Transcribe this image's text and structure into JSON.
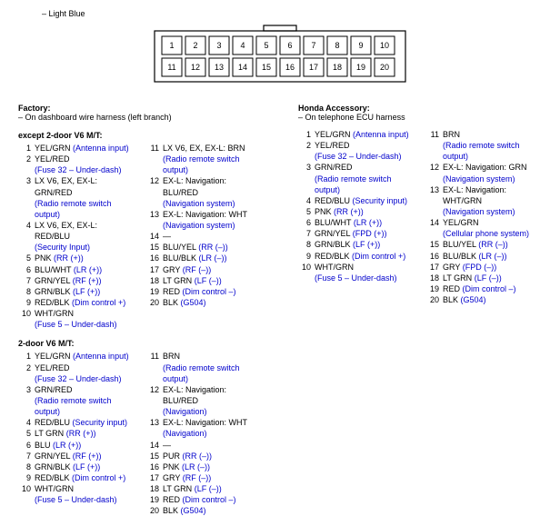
{
  "top_note": "– Light Blue",
  "connector_pins_row1": [
    "1",
    "2",
    "3",
    "4",
    "5",
    "6",
    "7",
    "8",
    "9",
    "10"
  ],
  "connector_pins_row2": [
    "11",
    "12",
    "13",
    "14",
    "15",
    "16",
    "17",
    "18",
    "19",
    "20"
  ],
  "factory": {
    "title": "Factory:",
    "sub": "– On dashboard wire harness (left branch)",
    "groups": [
      {
        "title": "except 2-door V6 M/T:",
        "cols": [
          [
            {
              "n": "1",
              "c": "YEL/GRN",
              "f": "(Antenna input)"
            },
            {
              "n": "2",
              "c": "YEL/RED",
              "f": "",
              "f2": "(Fuse 32 – Under-dash)"
            },
            {
              "n": "3",
              "c": "LX V6, EX, EX-L: GRN/RED",
              "f": "",
              "f2": "(Radio remote switch output)"
            },
            {
              "n": "4",
              "c": "LX V6, EX, EX-L: RED/BLU",
              "f": "",
              "f2": "(Security Input)"
            },
            {
              "n": "5",
              "c": "PNK",
              "f": "(RR (+))"
            },
            {
              "n": "6",
              "c": "BLU/WHT",
              "f": "(LR (+))"
            },
            {
              "n": "7",
              "c": "GRN/YEL",
              "f": "(RF (+))"
            },
            {
              "n": "8",
              "c": "GRN/BLK",
              "f": "(LF (+))"
            },
            {
              "n": "9",
              "c": "RED/BLK",
              "f": "(Dim control +)"
            },
            {
              "n": "10",
              "c": "WHT/GRN",
              "f": "",
              "f2": "(Fuse 5 – Under-dash)"
            }
          ],
          [
            {
              "n": "11",
              "c": "LX V6, EX, EX-L: BRN",
              "f": "",
              "f2": "(Radio remote switch output)"
            },
            {
              "n": "12",
              "c": "EX-L: Navigation: BLU/RED",
              "f": "",
              "f2": "(Navigation system)"
            },
            {
              "n": "13",
              "c": "EX-L: Navigation: WHT",
              "f": "",
              "f2": "(Navigation system)"
            },
            {
              "n": "14",
              "c": "—",
              "f": ""
            },
            {
              "n": "15",
              "c": "BLU/YEL",
              "f": "(RR (–))"
            },
            {
              "n": "16",
              "c": "BLU/BLK",
              "f": "(LR (–))"
            },
            {
              "n": "17",
              "c": "GRY",
              "f": "(RF (–))"
            },
            {
              "n": "18",
              "c": "LT GRN",
              "f": "(LF (–))"
            },
            {
              "n": "19",
              "c": "RED",
              "f": "(Dim control –)"
            },
            {
              "n": "20",
              "c": "BLK",
              "f": "(G504)"
            }
          ]
        ]
      },
      {
        "title": "2-door V6 M/T:",
        "cols": [
          [
            {
              "n": "1",
              "c": "YEL/GRN",
              "f": "(Antenna input)"
            },
            {
              "n": "2",
              "c": "YEL/RED",
              "f": "",
              "f2": "(Fuse 32 – Under-dash)"
            },
            {
              "n": "3",
              "c": "GRN/RED",
              "f": "",
              "f2": "(Radio remote switch output)"
            },
            {
              "n": "4",
              "c": "RED/BLU",
              "f": "(Security input)"
            },
            {
              "n": "5",
              "c": "LT GRN",
              "f": "(RR (+))"
            },
            {
              "n": "6",
              "c": "BLU",
              "f": "(LR (+))"
            },
            {
              "n": "7",
              "c": "GRN/YEL",
              "f": "(RF (+))"
            },
            {
              "n": "8",
              "c": "GRN/BLK",
              "f": "(LF (+))"
            },
            {
              "n": "9",
              "c": "RED/BLK",
              "f": "(Dim control +)"
            },
            {
              "n": "10",
              "c": "WHT/GRN",
              "f": "",
              "f2": "(Fuse 5 – Under-dash)"
            }
          ],
          [
            {
              "n": "11",
              "c": "BRN",
              "f": "",
              "f2": "(Radio remote switch output)"
            },
            {
              "n": "12",
              "c": "EX-L: Navigation: BLU/RED",
              "f": "",
              "f2": "(Navigation)"
            },
            {
              "n": "13",
              "c": "EX-L: Navigation: WHT",
              "f": "",
              "f2": "(Navigation)"
            },
            {
              "n": "14",
              "c": "—",
              "f": ""
            },
            {
              "n": "15",
              "c": "PUR",
              "f": "(RR (–))"
            },
            {
              "n": "16",
              "c": "PNK",
              "f": "(LR (–))"
            },
            {
              "n": "17",
              "c": "GRY",
              "f": "(RF (–))"
            },
            {
              "n": "18",
              "c": "LT GRN",
              "f": "(LF (–))"
            },
            {
              "n": "19",
              "c": "RED",
              "f": "(Dim control –)"
            },
            {
              "n": "20",
              "c": "BLK",
              "f": "(G504)"
            }
          ]
        ]
      }
    ]
  },
  "accessory": {
    "title": "Honda Accessory:",
    "sub": "– On telephone ECU harness",
    "cols": [
      [
        {
          "n": "1",
          "c": "YEL/GRN",
          "f": "(Antenna input)"
        },
        {
          "n": "2",
          "c": "YEL/RED",
          "f": "",
          "f2": "(Fuse 32 – Under-dash)"
        },
        {
          "n": "3",
          "c": "GRN/RED",
          "f": "",
          "f2": "(Radio remote switch output)"
        },
        {
          "n": "4",
          "c": "RED/BLU",
          "f": "(Security input)"
        },
        {
          "n": "5",
          "c": "PNK",
          "f": "(RR (+))"
        },
        {
          "n": "6",
          "c": "BLU/WHT",
          "f": "(LR (+))"
        },
        {
          "n": "7",
          "c": "GRN/YEL",
          "f": "(FPD (+))"
        },
        {
          "n": "8",
          "c": "GRN/BLK",
          "f": "(LF (+))"
        },
        {
          "n": "9",
          "c": "RED/BLK",
          "f": "(Dim control +)"
        },
        {
          "n": "10",
          "c": "WHT/GRN",
          "f": "",
          "f2": "(Fuse 5 – Under-dash)"
        }
      ],
      [
        {
          "n": "11",
          "c": "BRN",
          "f": "",
          "f2": "(Radio remote switch output)"
        },
        {
          "n": "12",
          "c": "EX-L: Navigation: GRN",
          "f": "",
          "f2": "(Navigation system)"
        },
        {
          "n": "13",
          "c": "EX-L: Navigation: WHT/GRN",
          "f": "",
          "f2": "(Navigation system)"
        },
        {
          "n": "14",
          "c": "YEL/GRN",
          "f": "",
          "f2": "(Cellular phone system)"
        },
        {
          "n": "15",
          "c": "BLU/YEL",
          "f": "(RR (–))"
        },
        {
          "n": "16",
          "c": "BLU/BLK",
          "f": "(LR (–))"
        },
        {
          "n": "17",
          "c": "GRY",
          "f": "(FPD (–))"
        },
        {
          "n": "18",
          "c": "LT GRN",
          "f": "(LF (–))"
        },
        {
          "n": "19",
          "c": "RED",
          "f": "(Dim control –)"
        },
        {
          "n": "20",
          "c": "BLK",
          "f": "(G504)"
        }
      ]
    ]
  }
}
